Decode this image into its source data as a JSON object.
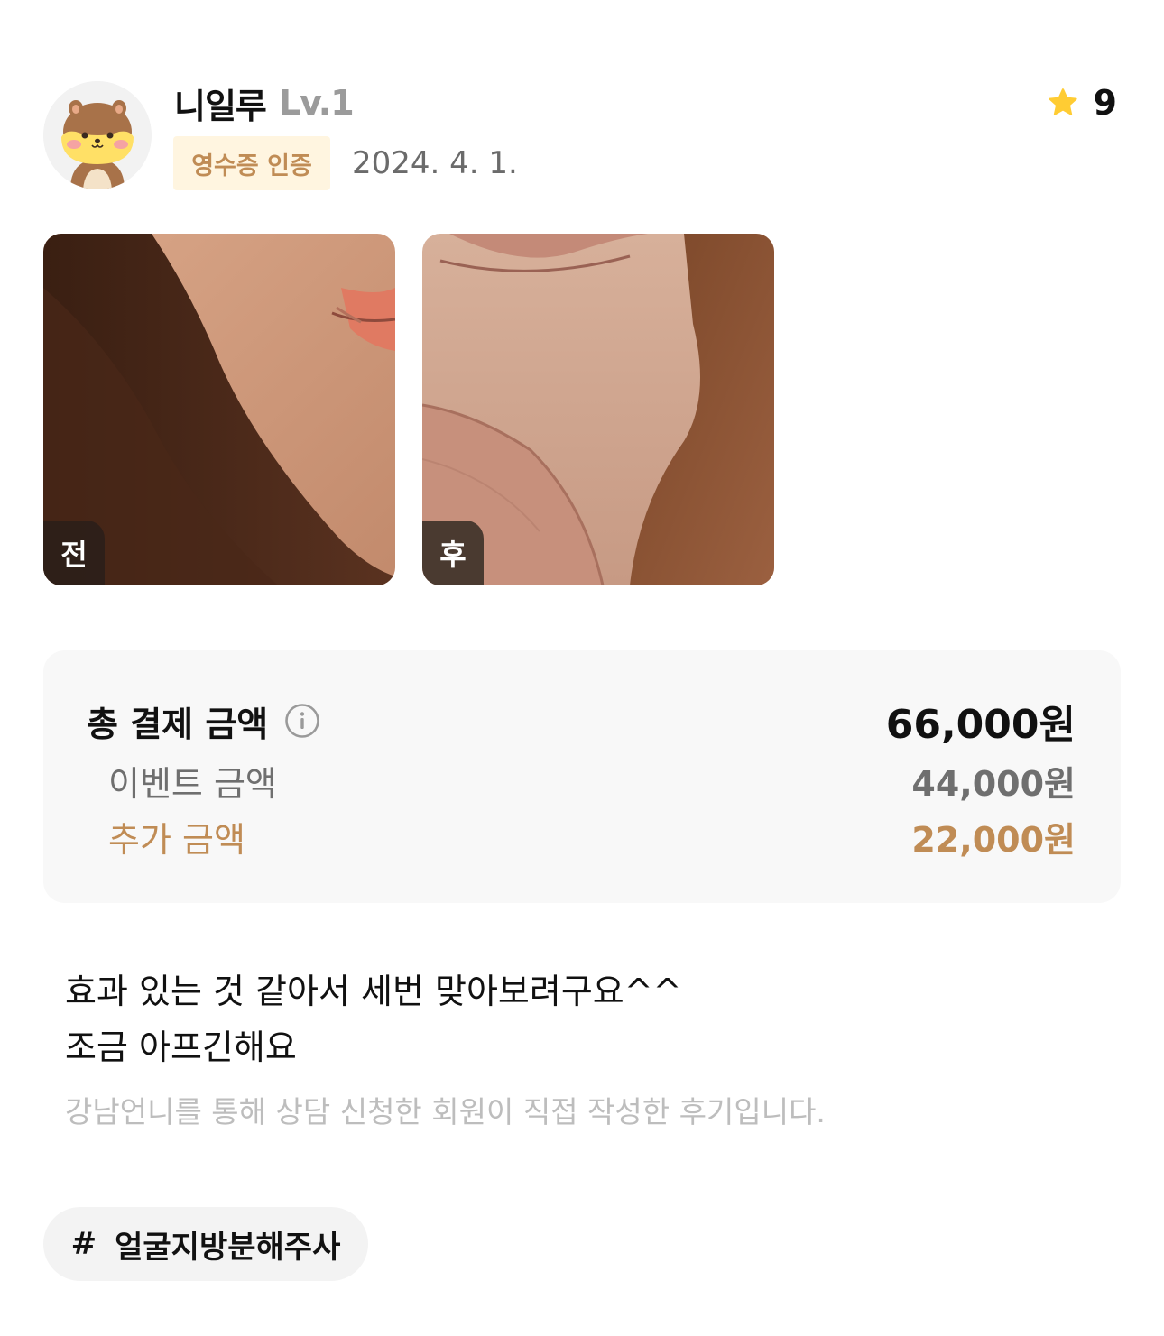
{
  "user": {
    "nickname": "니일루",
    "level": "Lv.1",
    "receipt_badge": "영수증 인증",
    "date": "2024. 4. 1.",
    "rating": "9"
  },
  "photos": {
    "before_label": "전",
    "after_label": "후"
  },
  "price": {
    "total_label": "총 결제 금액",
    "total_value": "66,000원",
    "event_label": "이벤트 금액",
    "event_value": "44,000원",
    "extra_label": "추가 금액",
    "extra_value": "22,000원"
  },
  "review": {
    "line1": "효과 있는 것 같아서 세번 맞아보려구요^^",
    "line2": "조금 아프긴해요",
    "disclaimer": "강남언니를 통해 상담 신청한 회원이 직접 작성한 후기입니다."
  },
  "hashtag": {
    "symbol": "#",
    "label": "얼굴지방분해주사"
  },
  "colors": {
    "accent_brown": "#c08c55",
    "badge_background": "#fff5e0",
    "star": "#ffcc33"
  },
  "icons": {
    "avatar": "hamster-avatar-icon",
    "rating": "star-icon",
    "info": "info-circle-icon"
  }
}
